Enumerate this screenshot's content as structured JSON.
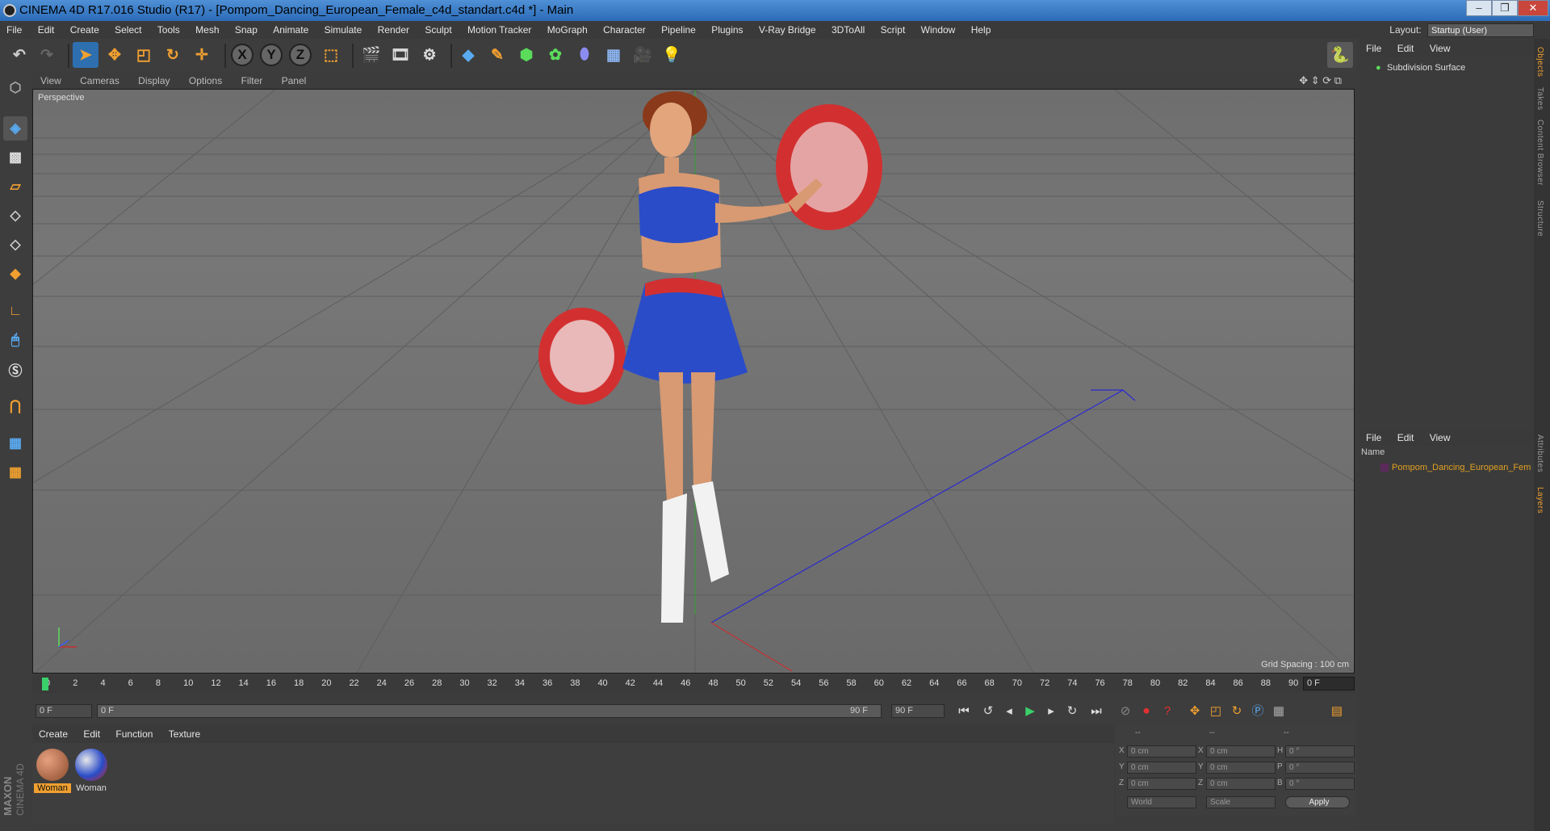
{
  "window": {
    "title": "CINEMA 4D R17.016 Studio (R17) - [Pompom_Dancing_European_Female_c4d_standart.c4d *] - Main",
    "controls": [
      "–",
      "❐",
      "✕"
    ]
  },
  "menubar": [
    "File",
    "Edit",
    "Create",
    "Select",
    "Tools",
    "Mesh",
    "Snap",
    "Animate",
    "Simulate",
    "Render",
    "Sculpt",
    "Motion Tracker",
    "MoGraph",
    "Character",
    "Pipeline",
    "Plugins",
    "V-Ray Bridge",
    "3DToAll",
    "Script",
    "Window",
    "Help"
  ],
  "layout": {
    "label": "Layout:",
    "value": "Startup (User)"
  },
  "viewport": {
    "menu": [
      "View",
      "Cameras",
      "Display",
      "Options",
      "Filter",
      "Panel"
    ],
    "label": "Perspective",
    "grid_spacing": "Grid Spacing : 100 cm"
  },
  "timeline": {
    "ticks": [
      "0",
      "2",
      "4",
      "6",
      "8",
      "10",
      "12",
      "14",
      "16",
      "18",
      "20",
      "22",
      "24",
      "26",
      "28",
      "30",
      "32",
      "34",
      "36",
      "38",
      "40",
      "42",
      "44",
      "46",
      "48",
      "50",
      "52",
      "54",
      "56",
      "58",
      "60",
      "62",
      "64",
      "66",
      "68",
      "70",
      "72",
      "74",
      "76",
      "78",
      "80",
      "82",
      "84",
      "86",
      "88",
      "90"
    ],
    "current_frame": "0 F"
  },
  "playbar": {
    "start": "0 F",
    "range_start": "0 F",
    "range_end": "90 F",
    "end": "90 F"
  },
  "materials": {
    "menu": [
      "Create",
      "Edit",
      "Function",
      "Texture"
    ],
    "items": [
      {
        "name": "Woman",
        "color": "#8a4a2a"
      },
      {
        "name": "Woman",
        "color": "#2a4cc8"
      }
    ]
  },
  "coords": {
    "headers": [
      "--",
      "--",
      "--"
    ],
    "rows": [
      {
        "a": "X",
        "av": "0 cm",
        "b": "X",
        "bv": "0 cm",
        "c": "H",
        "cv": "0 °"
      },
      {
        "a": "Y",
        "av": "0 cm",
        "b": "Y",
        "bv": "0 cm",
        "c": "P",
        "cv": "0 °"
      },
      {
        "a": "Z",
        "av": "0 cm",
        "b": "Z",
        "bv": "0 cm",
        "c": "B",
        "cv": "0 °"
      }
    ],
    "world": "World",
    "scale": "Scale",
    "apply": "Apply"
  },
  "objects_panel": {
    "menu": [
      "File",
      "Edit",
      "View"
    ],
    "item": "Subdivision Surface"
  },
  "layers_panel": {
    "menu": [
      "File",
      "Edit",
      "View"
    ],
    "header": "Name",
    "item": "Pompom_Dancing_European_Fem"
  },
  "side_tabs": [
    "Objects",
    "Takes",
    "Content Browser",
    "Structure",
    "Attributes",
    "Layers"
  ],
  "brand": [
    "MAXON",
    "CINEMA 4D"
  ],
  "colors": {
    "accent": "#f0a030",
    "selected_layer": "#e0a020",
    "active_tool": "#2e6fb0"
  }
}
